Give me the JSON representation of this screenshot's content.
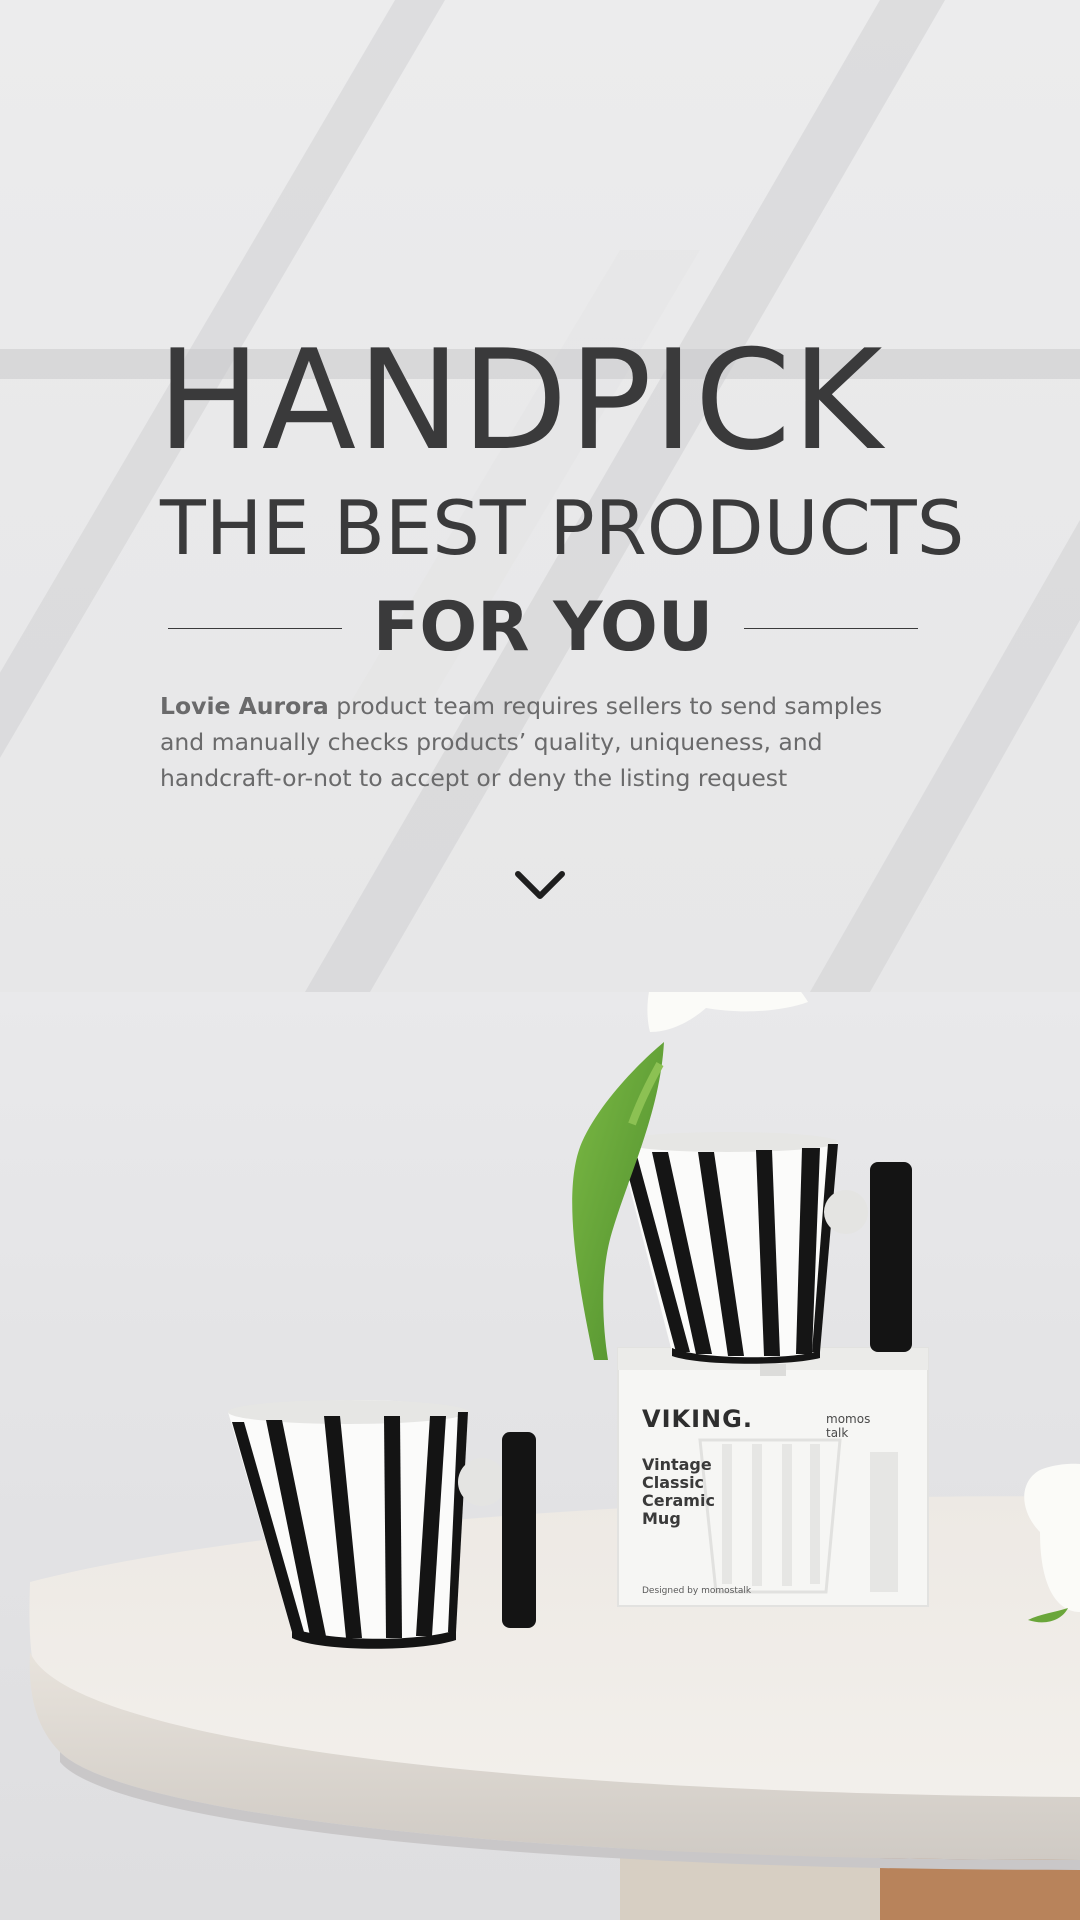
{
  "hero": {
    "headline_line1": "HANDPICK",
    "headline_line2": "THE BEST PRODUCTS",
    "headline_line3": "FOR YOU",
    "description_brand": "Lovie Aurora",
    "description_text": " product team requires sellers to send samples and manually checks products’ quality, uniqueness, and handcraft-or-not to accept or deny the listing request"
  },
  "scroll_icon": "chevron-down-icon",
  "photo": {
    "box_brand": "VIKING.",
    "box_brand_small_1": "momos",
    "box_brand_small_2": "talk",
    "box_lines": [
      "Vintage",
      "Classic",
      "Ceramic",
      "Mug"
    ],
    "box_footer": "Designed by momostalk"
  },
  "colors": {
    "headline": "#3a3a3b",
    "body_text": "#6a6a6b",
    "background": "#e9e9ea"
  }
}
